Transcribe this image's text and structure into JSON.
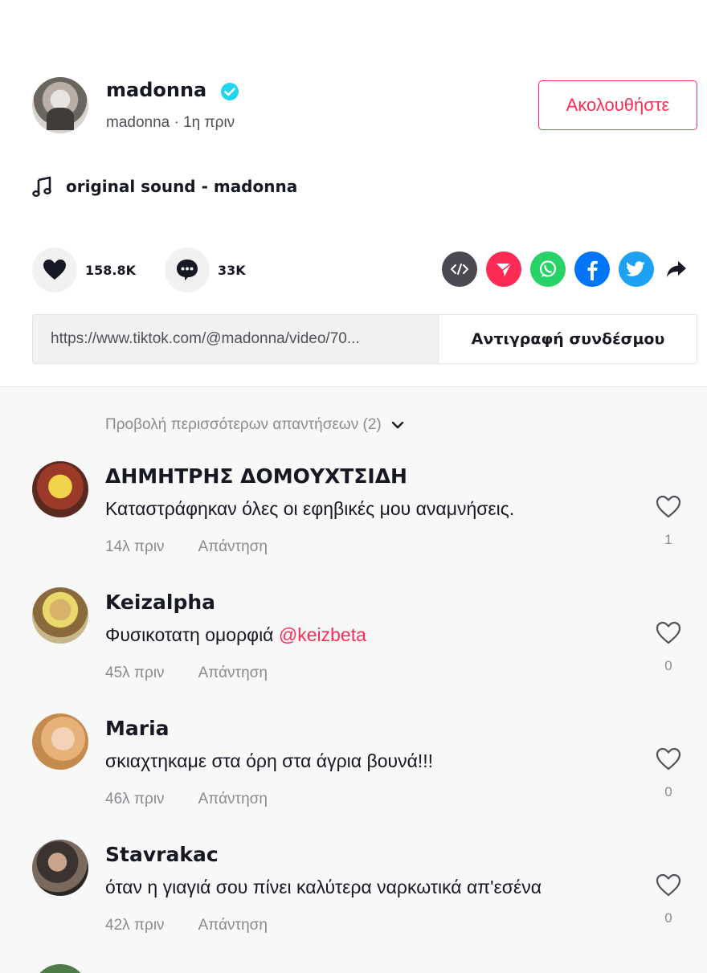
{
  "post": {
    "author": "madonna",
    "subtitle": "madonna · 1η πριν",
    "follow_label": "Ακολουθήστε",
    "music": "original sound - madonna"
  },
  "actions": {
    "likes": "158.8K",
    "comments": "33K"
  },
  "share": {
    "icons": [
      "embed-icon",
      "send-icon",
      "whatsapp-icon",
      "facebook-icon",
      "twitter-icon",
      "share-arrow-icon"
    ],
    "colors": {
      "embed": "#4a4b52",
      "send": "#fe2c55",
      "whatsapp": "#25d366",
      "facebook": "#0075fa",
      "twitter": "#1da1f2"
    }
  },
  "link": {
    "url": "https://www.tiktok.com/@madonna/video/70...",
    "copy_label": "Αντιγραφή συνδέσμου"
  },
  "replies": {
    "view_more": "Προβολή περισσότερων απαντήσεων (2)"
  },
  "comments": [
    {
      "user": "ΔΗΜΗΤΡΗΣ ΔΟΜΟΥΧΤΣΙΔΗ",
      "text": "Καταστράφηκαν όλες οι εφηβικές μου αναμνήσεις.",
      "mention": "",
      "time": "14λ πριν",
      "reply": "Απάντηση",
      "likes": "1"
    },
    {
      "user": "Keizalpha",
      "text": "Φυσικοτατη ομορφιά ",
      "mention": "@keizbeta",
      "time": "45λ πριν",
      "reply": "Απάντηση",
      "likes": "0"
    },
    {
      "user": "Maria",
      "text": "σκιαχτηκαμε στα όρη στα άγρια βουνά!!!",
      "mention": "",
      "time": "46λ πριν",
      "reply": "Απάντηση",
      "likes": "0"
    },
    {
      "user": "Stavrakac",
      "text": "όταν η γιαγιά σου πίνει καλύτερα ναρκωτικά απ'εσένα",
      "mention": "",
      "time": "42λ πριν",
      "reply": "Απάντηση",
      "likes": "0"
    }
  ],
  "colors": {
    "accent": "#fe2c55",
    "verified": "#20d5ec"
  }
}
